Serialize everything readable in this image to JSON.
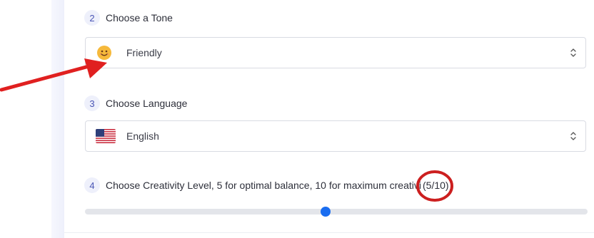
{
  "steps": [
    {
      "number": "2",
      "label": "Choose a Tone"
    },
    {
      "number": "3",
      "label": "Choose Language"
    },
    {
      "number": "4",
      "label": "Choose Creativity Level, 5 for optimal balance, 10 for maximum creativity"
    }
  ],
  "tone_select": {
    "value": "Friendly",
    "icon": "smiling-face-icon"
  },
  "language_select": {
    "value": "English",
    "icon": "us-flag-icon"
  },
  "creativity": {
    "level_text": "(5/10)",
    "value": 5,
    "max": 10
  },
  "annotations": {
    "arrow_color": "#e02020",
    "circle_color": "#cc1f1f"
  }
}
